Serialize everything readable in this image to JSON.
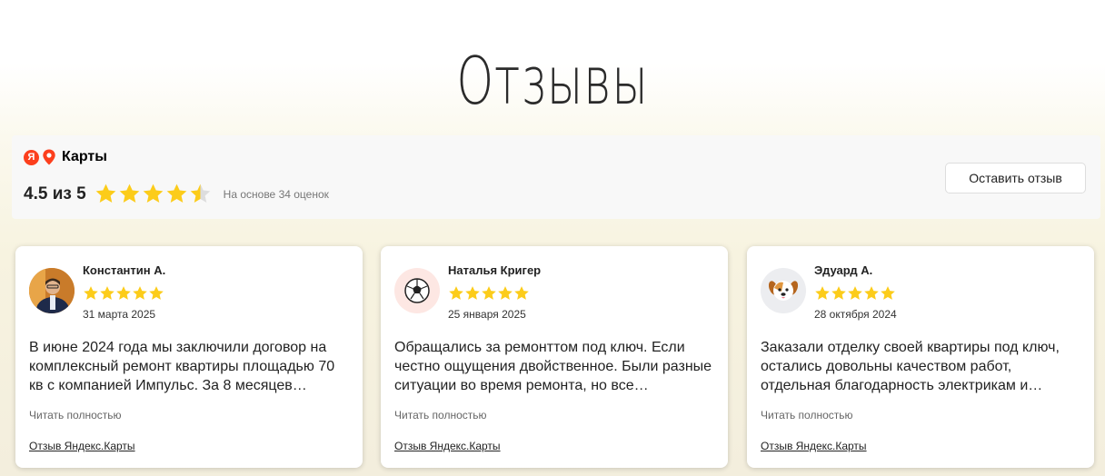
{
  "page": {
    "title": "Отзывы"
  },
  "summary": {
    "brand_logo_letter": "Я",
    "brand_label": "Карты",
    "rating_text": "4.5 из 5",
    "rating_value": 4.5,
    "rating_max": 5,
    "based_on": "На основе 34 оценок",
    "leave_review_label": "Оставить отзыв"
  },
  "colors": {
    "star": "#fccc1a",
    "star_empty": "#dddddd",
    "yandex_red": "#fc3f1d"
  },
  "reviews": [
    {
      "name": "Константин А.",
      "rating": 5,
      "date": "31 марта 2025",
      "avatar": "user-photo-icon",
      "text": "В июне 2024 года мы заключили договор на комплексный ремонт квартиры площадью 70 кв с компанией Импульс. За 8 месяцев…",
      "read_more": "Читать полностью",
      "source": "Отзыв Яндекс.Карты"
    },
    {
      "name": "Наталья Кригер",
      "rating": 5,
      "date": "25 января 2025",
      "avatar": "soccer-ball-icon",
      "text": "Обращались за ремонттом под ключ. Если честно ощущения двойственное. Были разные ситуации во время ремонта, но все…",
      "read_more": "Читать полностью",
      "source": "Отзыв Яндекс.Карты"
    },
    {
      "name": "Эдуард А.",
      "rating": 5,
      "date": "28 октября 2024",
      "avatar": "dog-face-icon",
      "text": "Заказали отделку своей квартиры под ключ, остались довольны качеством работ, отдельная благодарность электрикам и…",
      "read_more": "Читать полностью",
      "source": "Отзыв Яндекс.Карты"
    }
  ]
}
